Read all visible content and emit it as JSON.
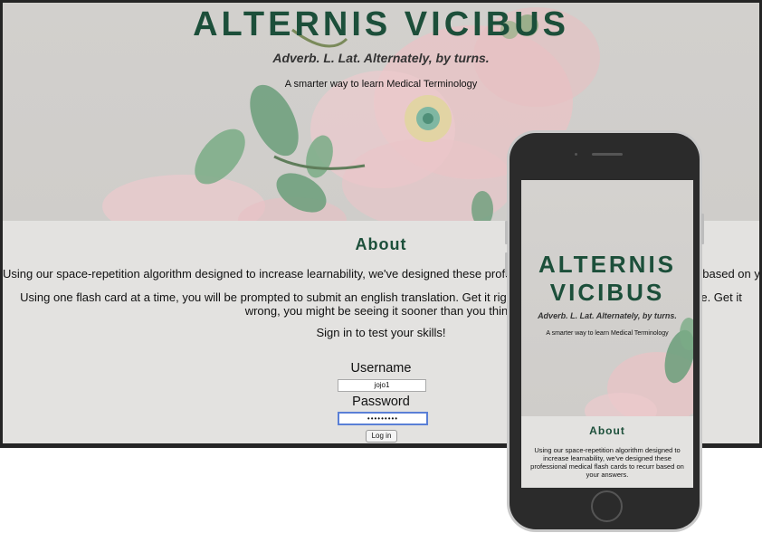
{
  "site": {
    "title": "ALTERNIS VICIBUS",
    "subtitle": "Adverb. L. Lat. Alternately, by turns.",
    "tagline": "A smarter way to learn Medical Terminology"
  },
  "about": {
    "heading": "About",
    "para1": "Using our space-repetition algorithm designed to increase learnability, we've designed these professional medical flash cards to recurr based on your answers.",
    "para2": "Using one flash card at a time, you will be prompted to submit an english translation. Get it right, you may not see it again for a while. Get it wrong, you might be seeing it sooner than you think.",
    "para3": "Sign in to test your skills!"
  },
  "login": {
    "username_label": "Username",
    "username_value": "jojo1",
    "password_label": "Password",
    "password_value": "•••••••••",
    "login_button": "Log in"
  },
  "phone": {
    "title": "ALTERNIS VICIBUS",
    "subtitle": "Adverb. L. Lat. Alternately, by turns.",
    "tagline": "A smarter way to learn Medical Terminology",
    "about_heading": "About",
    "about_para": "Using our space-repetition algorithm designed to increase learnability, we've designed these professional medical flash cards to recurr based on your answers."
  },
  "colors": {
    "accent": "#1c4f3a",
    "background": "#e3e2e0",
    "frame": "#252525"
  }
}
